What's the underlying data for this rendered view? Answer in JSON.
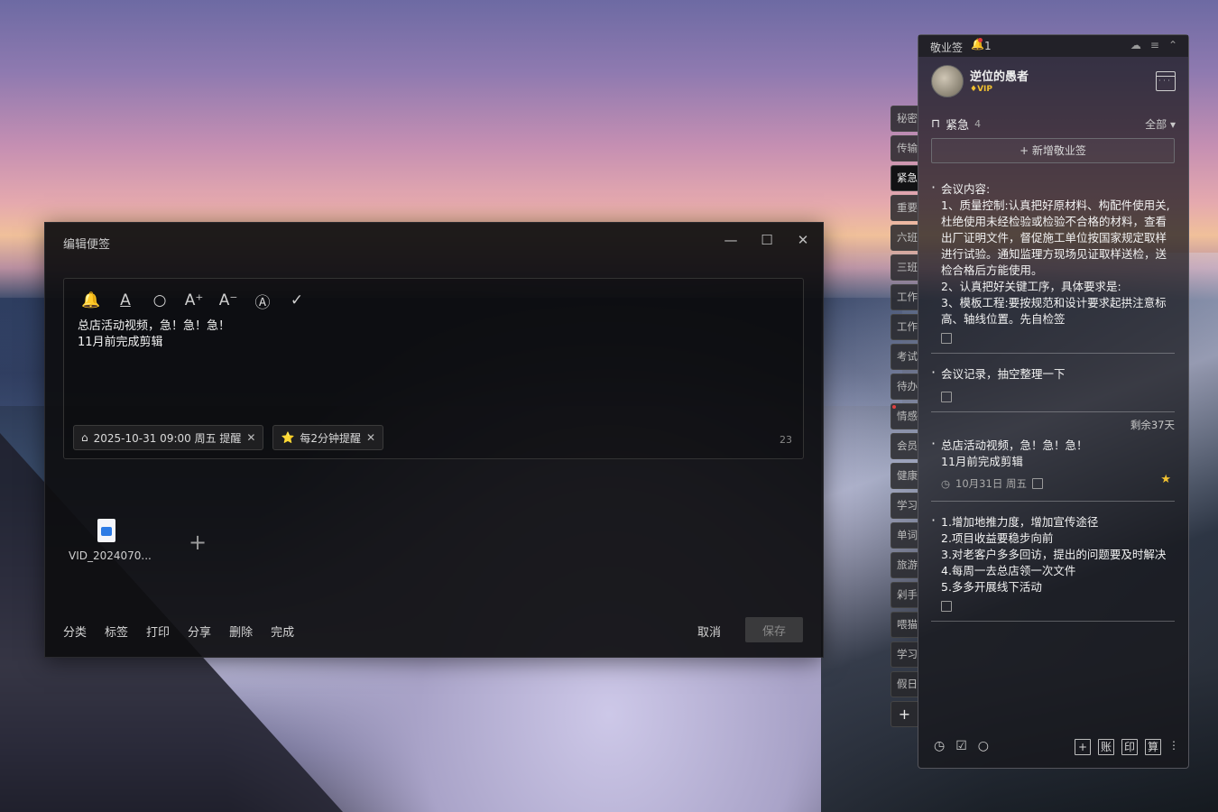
{
  "editor": {
    "title": "编辑便签",
    "window_controls": [
      "—",
      "☐",
      "✕"
    ],
    "toolbar_icons": [
      "bell-icon",
      "text-color-icon",
      "search-icon",
      "font-increase-icon",
      "font-decrease-icon",
      "format-icon",
      "check-icon"
    ],
    "toolbar_glyphs": [
      "🔔",
      "A",
      "○",
      "A⁺",
      "A⁻",
      "Ⓐ",
      "✓"
    ],
    "note_text": "总店活动视频，急！急！急！\n11月前完成剪辑",
    "tags": [
      {
        "icon": "⌂",
        "label": "2025-10-31 09:00 周五 提醒"
      },
      {
        "icon": "⭐",
        "label": "每2分钟提醒"
      }
    ],
    "char_count": "23",
    "attachment": {
      "name": "VID_2024070..."
    },
    "add_glyph": "+",
    "actions": [
      "分类",
      "标签",
      "打印",
      "分享",
      "删除",
      "完成"
    ],
    "cancel_label": "取消",
    "save_label": "保存"
  },
  "side_tabs": [
    {
      "label": "秘密",
      "active": false,
      "dot": false
    },
    {
      "label": "传输",
      "active": false,
      "dot": false
    },
    {
      "label": "紧急",
      "active": true,
      "dot": false
    },
    {
      "label": "重要",
      "active": false,
      "dot": false
    },
    {
      "label": "六班",
      "active": false,
      "dot": false
    },
    {
      "label": "三班",
      "active": false,
      "dot": false
    },
    {
      "label": "工作",
      "active": false,
      "dot": false
    },
    {
      "label": "工作",
      "active": false,
      "dot": false
    },
    {
      "label": "考试",
      "active": false,
      "dot": false
    },
    {
      "label": "待办",
      "active": false,
      "dot": false
    },
    {
      "label": "情感",
      "active": false,
      "dot": true
    },
    {
      "label": "会员",
      "active": false,
      "dot": false
    },
    {
      "label": "健康",
      "active": false,
      "dot": false
    },
    {
      "label": "学习",
      "active": false,
      "dot": false
    },
    {
      "label": "单词",
      "active": false,
      "dot": false
    },
    {
      "label": "旅游",
      "active": false,
      "dot": false
    },
    {
      "label": "剁手",
      "active": false,
      "dot": false
    },
    {
      "label": "喂猫",
      "active": false,
      "dot": false
    },
    {
      "label": "学习",
      "active": false,
      "dot": false
    },
    {
      "label": "假日",
      "active": false,
      "dot": false
    }
  ],
  "side_add": "+",
  "panel": {
    "app_title": "敬业签",
    "notify_count": "1",
    "top_icons": [
      "☁",
      "≡",
      "⌃"
    ],
    "user": {
      "name": "逆位的愚者",
      "badge": "♦VIP"
    },
    "category": {
      "name": "紧急",
      "count": "4"
    },
    "filter_label": "全部 ▾",
    "new_button": "+ 新增敬业签",
    "notes": [
      {
        "text": "会议内容:\n1、质量控制:认真把好原材料、构配件使用关,杜绝使用未经检验或检验不合格的材料，查看出厂证明文件，督促施工单位按国家规定取样进行试验。通知监理方现场见证取样送检，送检合格后方能使用。\n2、认真把好关键工序，具体要求是:\n3、模板工程:要按规范和设计要求起拱注意标高、轴线位置。先自检签"
      },
      {
        "text": "会议记录，抽空整理一下"
      },
      {
        "remain": "剩余37天",
        "text": "总店活动视频，急！急！急！\n11月前完成剪辑",
        "date": "10月31日 周五"
      },
      {
        "text": "1.增加地推力度，增加宣传途径\n2.项目收益要稳步向前\n3.对老客户多多回访，提出的问题要及时解决\n4.每周一去总店领一次文件\n5.多多开展线下活动"
      }
    ],
    "footer_left_icons": [
      "◷",
      "☑",
      "○"
    ],
    "footer_right_labels": [
      "+",
      "账",
      "印",
      "算",
      "⋮"
    ]
  }
}
